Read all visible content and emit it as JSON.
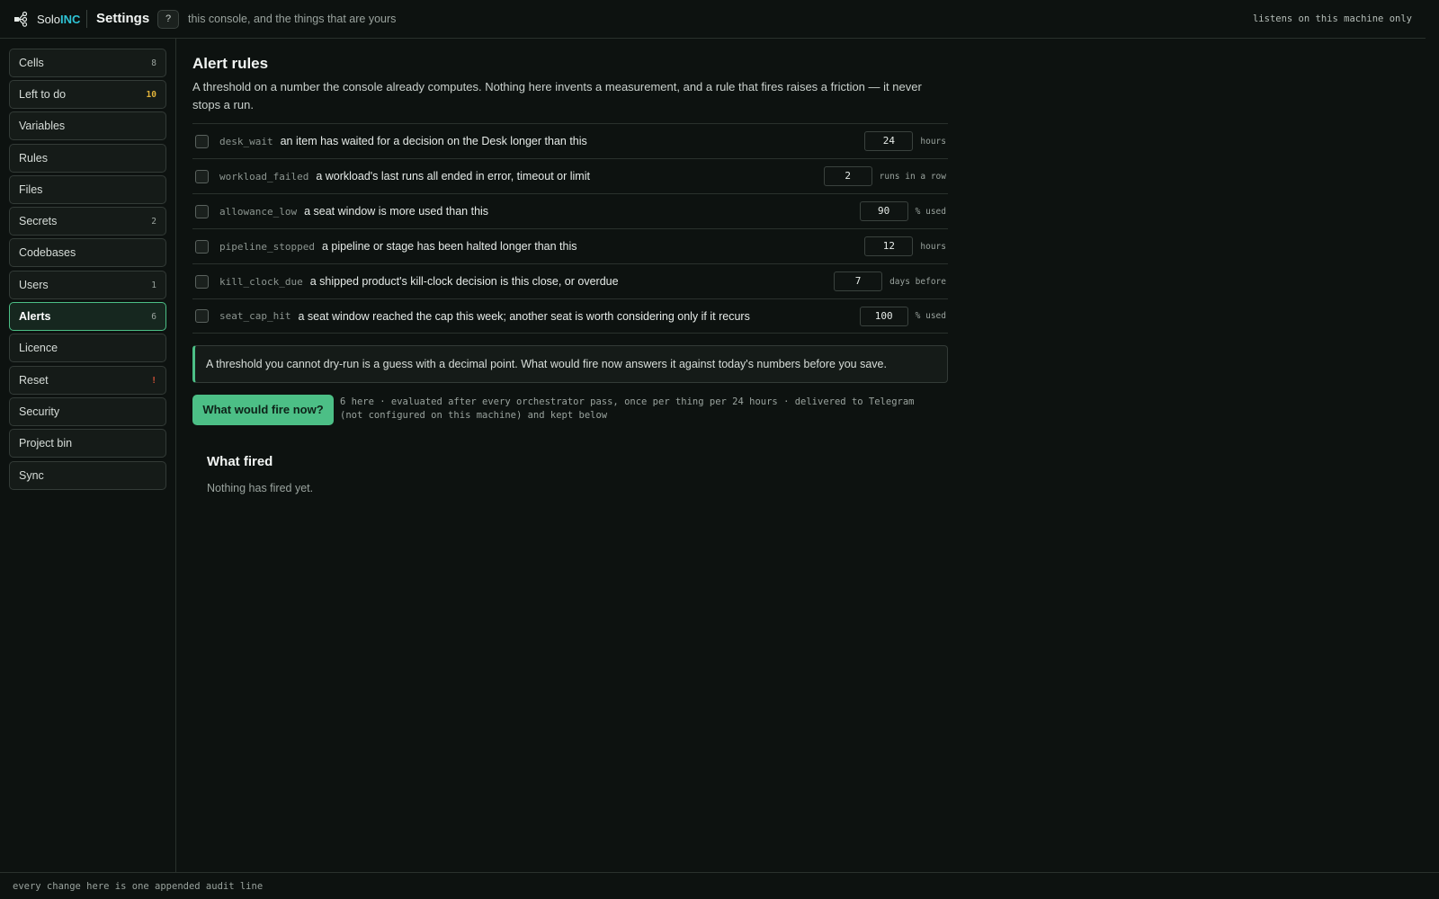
{
  "header": {
    "brand_solo": "Solo",
    "brand_inc": "INC",
    "title": "Settings",
    "help_label": "?",
    "tagline": "this console, and the things that are yours",
    "listen_note": "listens on this machine only"
  },
  "sidebar": {
    "items": [
      {
        "label": "Cells",
        "count": "8"
      },
      {
        "label": "Left to do",
        "count": "10"
      },
      {
        "label": "Variables",
        "count": ""
      },
      {
        "label": "Rules",
        "count": ""
      },
      {
        "label": "Files",
        "count": ""
      },
      {
        "label": "Secrets",
        "count": "2"
      },
      {
        "label": "Codebases",
        "count": ""
      },
      {
        "label": "Users",
        "count": "1"
      },
      {
        "label": "Alerts",
        "count": "6"
      },
      {
        "label": "Licence",
        "count": ""
      },
      {
        "label": "Reset",
        "count": "!"
      },
      {
        "label": "Security",
        "count": ""
      },
      {
        "label": "Project bin",
        "count": ""
      },
      {
        "label": "Sync",
        "count": ""
      }
    ]
  },
  "main": {
    "title": "Alert rules",
    "description": "A threshold on a number the console already computes. Nothing here invents a measurement, and a rule that fires raises a friction — it never stops a run.",
    "rules": [
      {
        "key": "desk_wait",
        "description": "an item has waited for a decision on the Desk longer than this",
        "value": "24",
        "unit": "hours"
      },
      {
        "key": "workload_failed",
        "description": "a workload's last runs all ended in error, timeout or limit",
        "value": "2",
        "unit": "runs in a row"
      },
      {
        "key": "allowance_low",
        "description": "a seat window is more used than this",
        "value": "90",
        "unit": "% used"
      },
      {
        "key": "pipeline_stopped",
        "description": "a pipeline or stage has been halted longer than this",
        "value": "12",
        "unit": "hours"
      },
      {
        "key": "kill_clock_due",
        "description": "a shipped product's kill-clock decision is this close, or overdue",
        "value": "7",
        "unit": "days before"
      },
      {
        "key": "seat_cap_hit",
        "description": "a seat window reached the cap this week; another seat is worth considering only if it recurs",
        "value": "100",
        "unit": "% used"
      }
    ],
    "callout": "A threshold you cannot dry-run is a guess with a decimal point. What would fire now answers it against today's numbers before you save.",
    "fire_button": "What would fire now?",
    "fire_note": "6 here · evaluated after every orchestrator pass, once per thing per 24 hours · delivered to Telegram (not configured on this machine) and kept below",
    "fired_title": "What fired",
    "fired_empty": "Nothing has fired yet."
  },
  "footer": {
    "text": "every change here is one appended audit line"
  },
  "colors": {
    "accent": "#4cbf86",
    "brand_inc": "#2ec4d6",
    "warn": "#e0b23a",
    "danger": "#e0563a"
  }
}
